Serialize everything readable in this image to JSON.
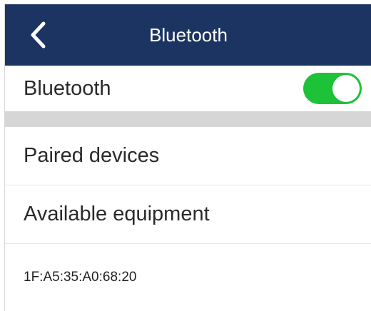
{
  "header": {
    "title": "Bluetooth",
    "back_icon": "chevron-left-icon"
  },
  "bluetooth": {
    "label": "Bluetooth",
    "enabled": true,
    "toggle_color": "#1ec238"
  },
  "menu": {
    "paired_devices_label": "Paired devices",
    "available_label": "Available equipment"
  },
  "devices": [
    {
      "address": "1F:A5:35:A0:68:20"
    }
  ],
  "colors": {
    "header_bg": "#1c3461",
    "divider": "#d6d6d6"
  }
}
